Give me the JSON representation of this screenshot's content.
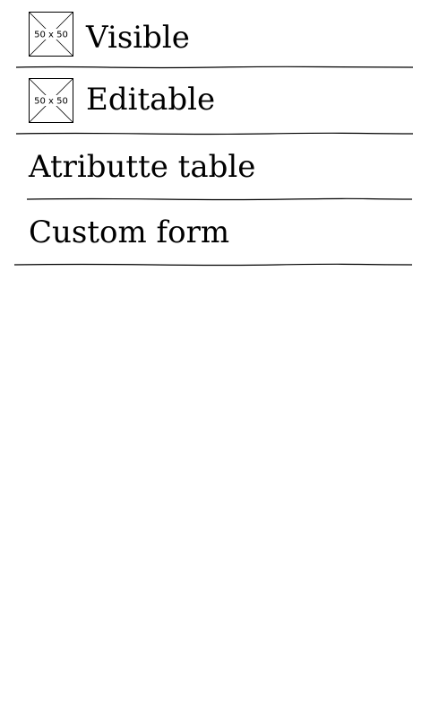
{
  "menu": {
    "items": [
      {
        "label": "Visible",
        "icon": "image-placeholder-icon",
        "icon_text": "50 x 50"
      },
      {
        "label": "Editable",
        "icon": "image-placeholder-icon",
        "icon_text": "50 x 50"
      },
      {
        "label": "Atributte table"
      },
      {
        "label": "Custom form"
      }
    ]
  },
  "colors": {
    "background": "#ffffff",
    "text": "#000000",
    "line": "#000000"
  }
}
